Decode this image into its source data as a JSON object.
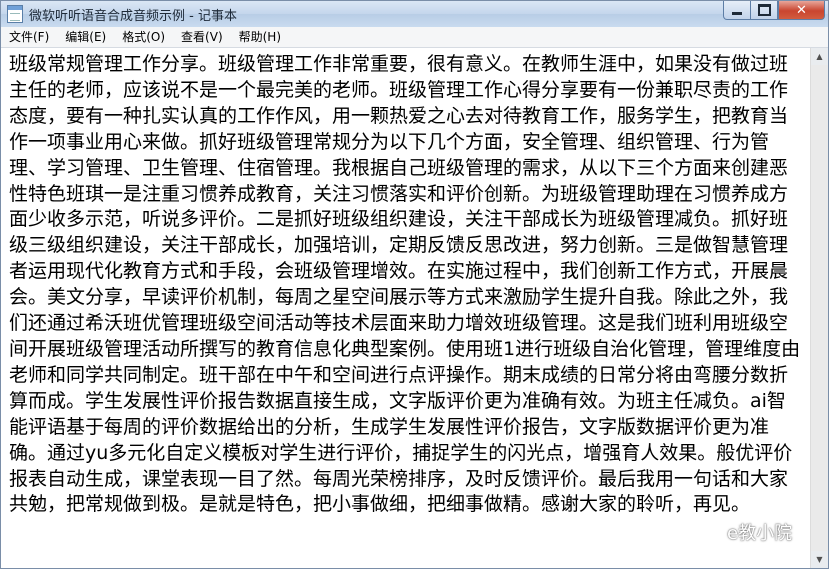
{
  "window": {
    "title": "微软听听语音合成音频示例 - 记事本"
  },
  "menu": [
    {
      "label": "文件(F)"
    },
    {
      "label": "编辑(E)"
    },
    {
      "label": "格式(O)"
    },
    {
      "label": "查看(V)"
    },
    {
      "label": "帮助(H)"
    }
  ],
  "document": {
    "text": "班级常规管理工作分享。班级管理工作非常重要，很有意义。在教师生涯中，如果没有做过班主任的老师，应该说不是一个最完美的老师。班级管理工作心得分享要有一份兼职尽责的工作态度，要有一种扎实认真的工作作风，用一颗热爱之心去对待教育工作，服务学生，把教育当作一项事业用心来做。抓好班级管理常规分为以下几个方面，安全管理、组织管理、行为管理、学习管理、卫生管理、住宿管理。我根据自己班级管理的需求，从以下三个方面来创建恶性特色班琪一是注重习惯养成教育，关注习惯落实和评价创新。为班级管理助理在习惯养成方面少收多示范，听说多评价。二是抓好班级组织建设，关注干部成长为班级管理减负。抓好班级三级组织建设，关注干部成长，加强培训，定期反馈反思改进，努力创新。三是做智慧管理者运用现代化教育方式和手段，会班级管理增效。在实施过程中，我们创新工作方式，开展晨会。美文分享，早读评价机制，每周之星空间展示等方式来激励学生提升自我。除此之外，我们还通过希沃班优管理班级空间活动等技术层面来助力增效班级管理。这是我们班利用班级空间开展班级管理活动所撰写的教育信息化典型案例。使用班1进行班级自治化管理，管理维度由老师和同学共同制定。班干部在中午和空间进行点评操作。期末成绩的日常分将由弯腰分数折算而成。学生发展性评价报告数据直接生成，文字版评价更为准确有效。为班主任减负。ai智能评语基于每周的评价数据给出的分析，生成学生发展性评价报告，文字版数据评价更为准确。通过yu多元化自定义模板对学生进行评价，捕捉学生的闪光点，增强育人效果。般优评价报表自动生成，课堂表现一目了然。每周光荣榜排序，及时反馈评价。最后我用一句话和大家共勉，把常规做到极。是就是特色，把小事做细，把细事做精。感谢大家的聆听，再见。"
  },
  "watermark": {
    "label": "e教小院",
    "icon": "wechat-icon"
  }
}
